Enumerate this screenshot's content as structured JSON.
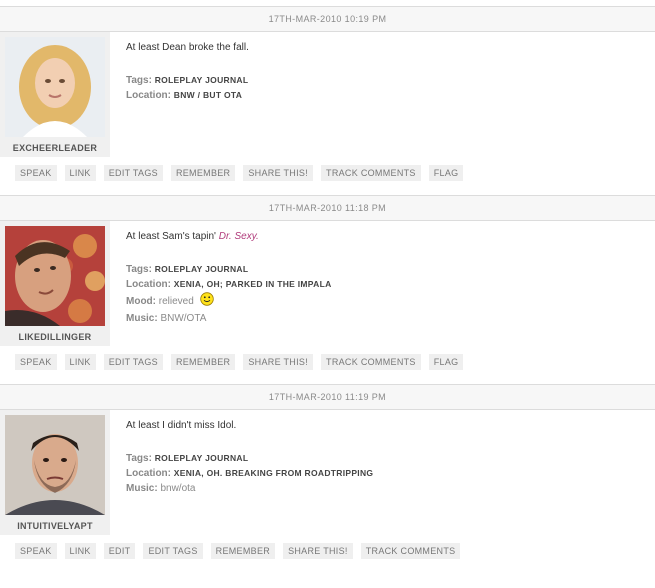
{
  "entries": [
    {
      "date": "17TH-MAR-2010 10:19 PM",
      "username": "EXCHEERLEADER",
      "subject": "At least Dean broke the fall.",
      "subject_em": "",
      "tags_label": "Tags:",
      "tags": "ROLEPLAY JOURNAL",
      "location_label": "Location:",
      "location": "BNW / BUT OTA",
      "actions": [
        "SPEAK",
        "LINK",
        "EDIT TAGS",
        "REMEMBER",
        "SHARE THIS!",
        "TRACK COMMENTS",
        "FLAG"
      ]
    },
    {
      "date": "17TH-MAR-2010 11:18 PM",
      "username": "LIKEDILLINGER",
      "subject": "At least Sam's tapin' ",
      "subject_em": "Dr. Sexy.",
      "tags_label": "Tags:",
      "tags": "ROLEPLAY JOURNAL",
      "location_label": "Location:",
      "location": "XENIA, OH; PARKED IN THE IMPALA",
      "mood_label": "Mood:",
      "mood": "relieved",
      "mood_icon": "smiley-icon",
      "music_label": "Music:",
      "music": "BNW/OTA",
      "actions": [
        "SPEAK",
        "LINK",
        "EDIT TAGS",
        "REMEMBER",
        "SHARE THIS!",
        "TRACK COMMENTS",
        "FLAG"
      ]
    },
    {
      "date": "17TH-MAR-2010 11:19 PM",
      "username": "INTUITIVELYAPT",
      "subject": "At least I didn't miss Idol.",
      "subject_em": "",
      "tags_label": "Tags:",
      "tags": "ROLEPLAY JOURNAL",
      "location_label": "Location:",
      "location": "XENIA, OH. BREAKING FROM ROADTRIPPING",
      "music_label": "Music:",
      "music": "bnw/ota",
      "actions": [
        "SPEAK",
        "LINK",
        "EDIT",
        "EDIT TAGS",
        "REMEMBER",
        "SHARE THIS!",
        "TRACK COMMENTS"
      ]
    }
  ],
  "colors": {
    "accent_em": "#b03a7a",
    "date_bar_bg": "#f7f7f7",
    "button_bg": "#efefef"
  }
}
